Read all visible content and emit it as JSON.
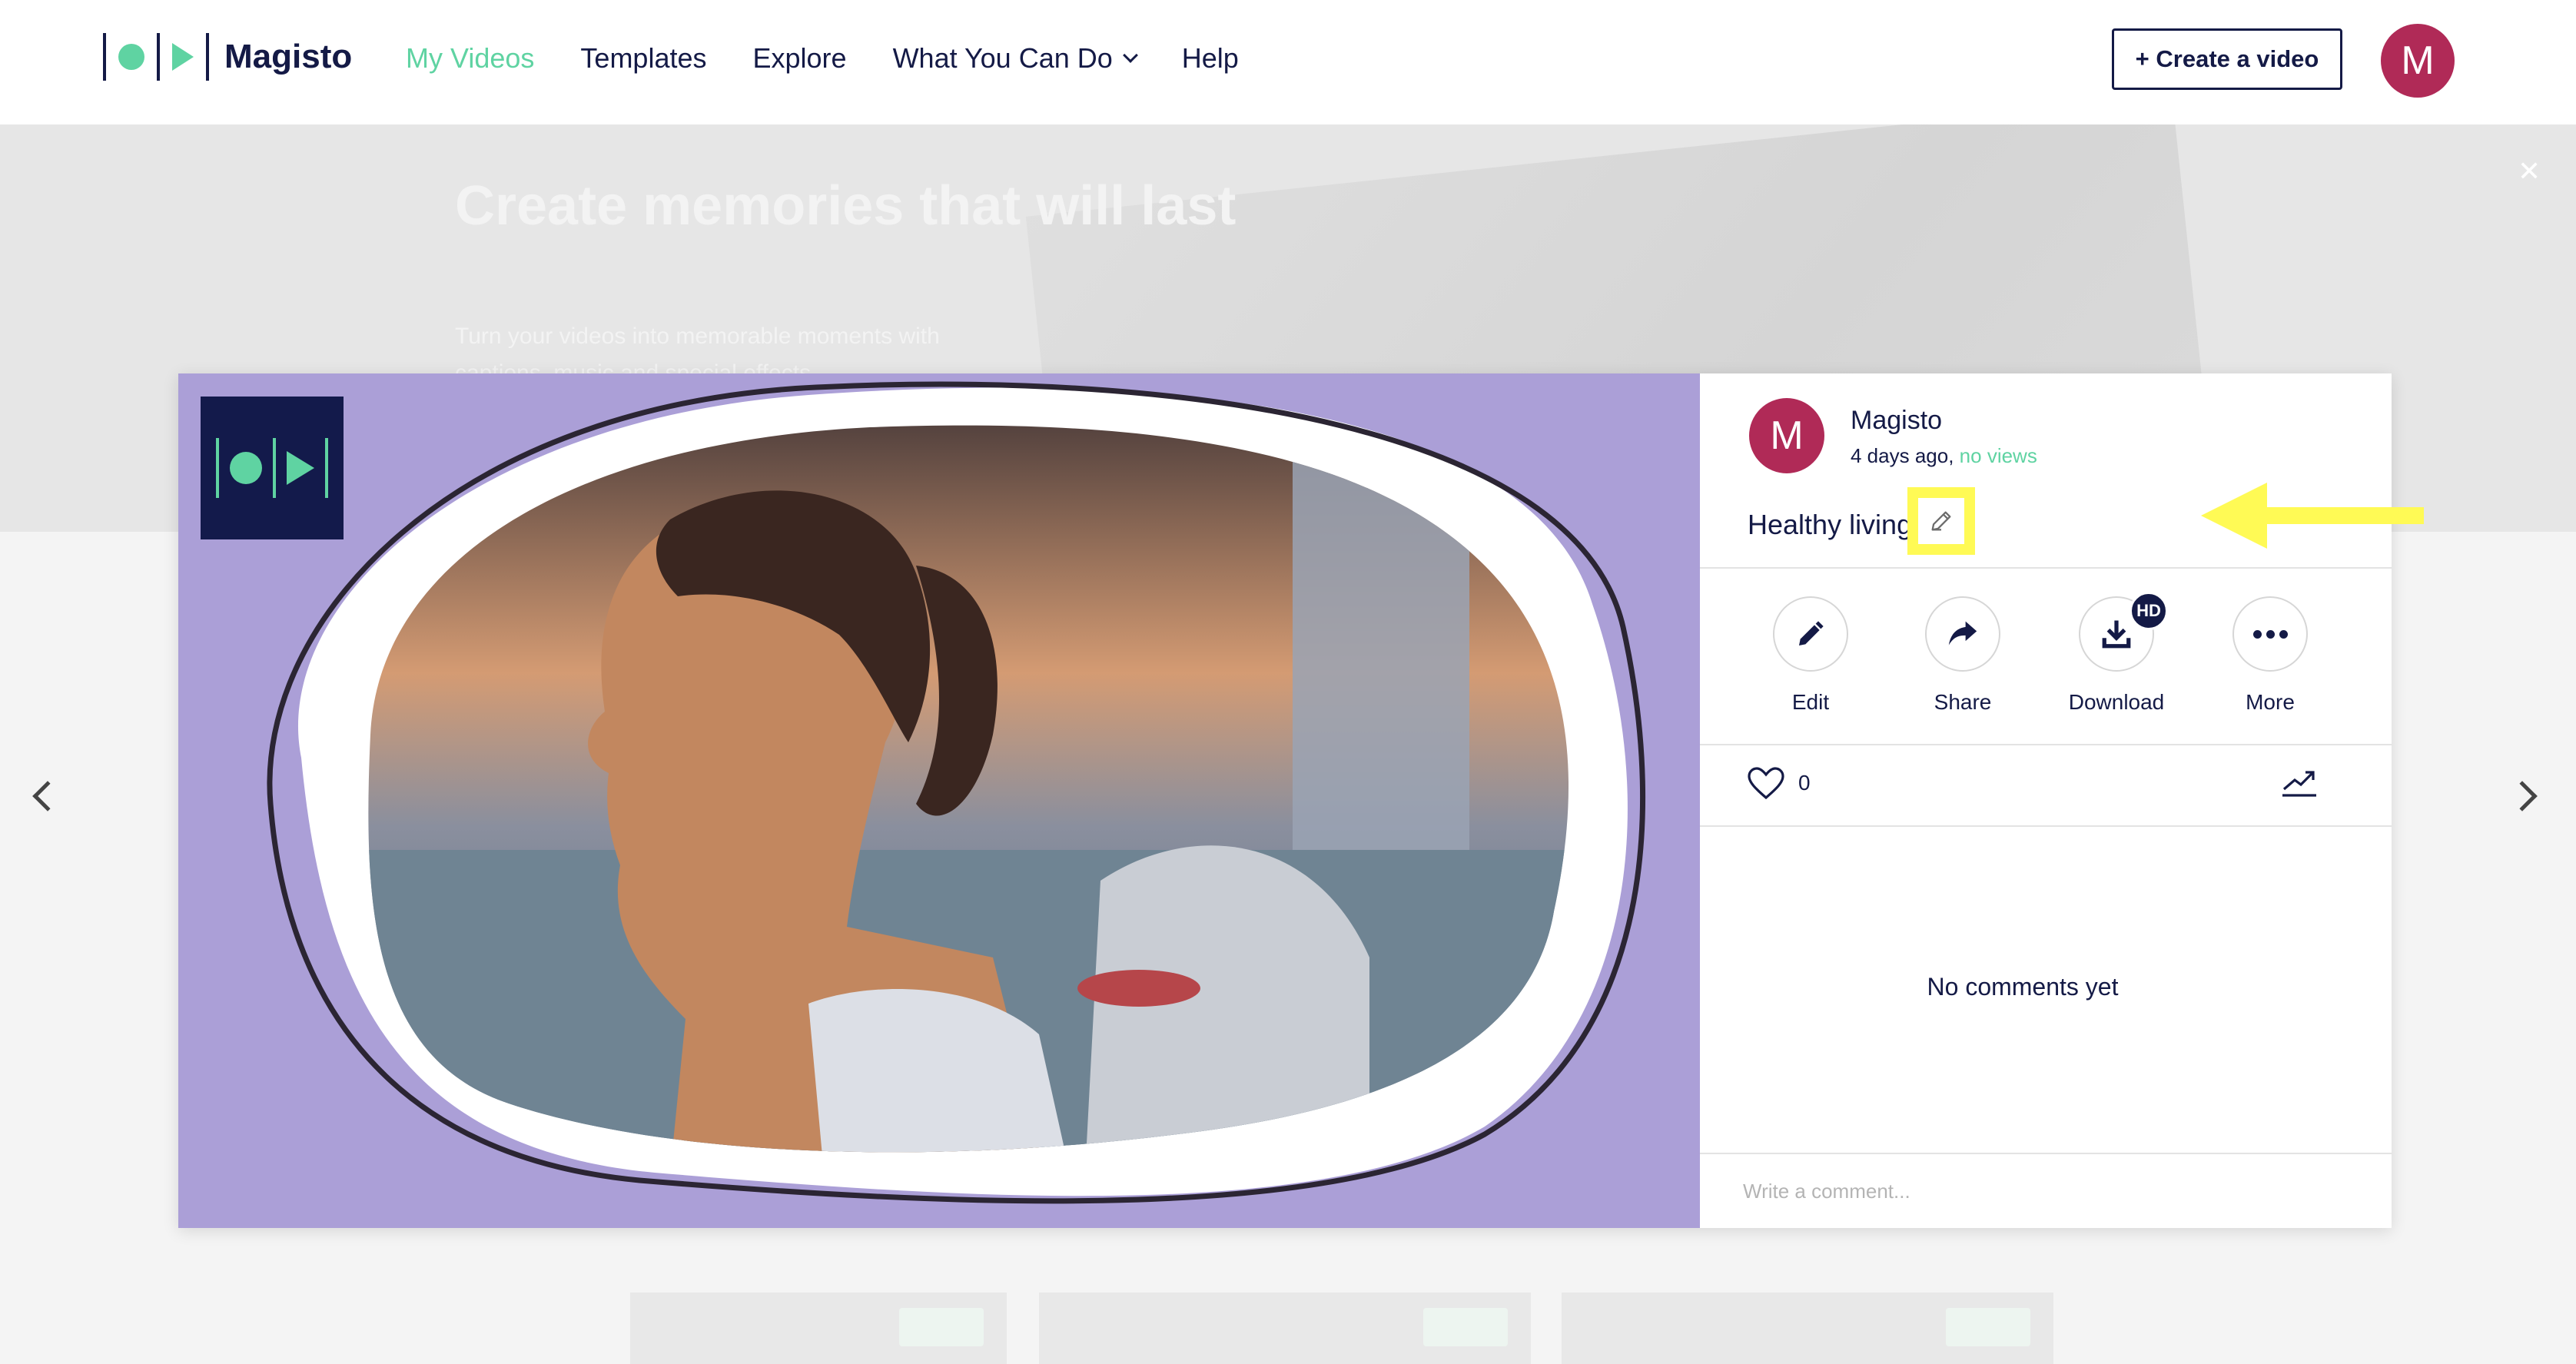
{
  "header": {
    "brand": "Magisto",
    "nav": [
      {
        "label": "My Videos",
        "active": true
      },
      {
        "label": "Templates",
        "active": false
      },
      {
        "label": "Explore",
        "active": false
      },
      {
        "label": "What You Can Do",
        "active": false,
        "dropdown": true
      },
      {
        "label": "Help",
        "active": false
      }
    ],
    "create_label": "+ Create a video",
    "avatar_letter": "M"
  },
  "hero": {
    "title": "Create memories that will last",
    "subtitle": "Turn your videos into memorable moments with captions, music and special effects"
  },
  "video": {
    "logo_icon": "magisto-logo-icon"
  },
  "panel": {
    "avatar_letter": "M",
    "author": "Magisto",
    "time": "4 days ago,",
    "views": "no views",
    "title": "Healthy living",
    "actions": [
      {
        "label": "Edit",
        "icon": "pencil-icon"
      },
      {
        "label": "Share",
        "icon": "share-icon"
      },
      {
        "label": "Download",
        "icon": "download-icon",
        "badge": "HD"
      },
      {
        "label": "More",
        "icon": "more-icon"
      }
    ],
    "likes": "0",
    "no_comments": "No comments yet",
    "comment_placeholder": "Write a comment..."
  },
  "colors": {
    "accent": "#5fd3a2",
    "navy": "#141a46",
    "avatar": "#b02a57",
    "video_bg": "#ab9fd7",
    "highlight": "#fffa55"
  }
}
